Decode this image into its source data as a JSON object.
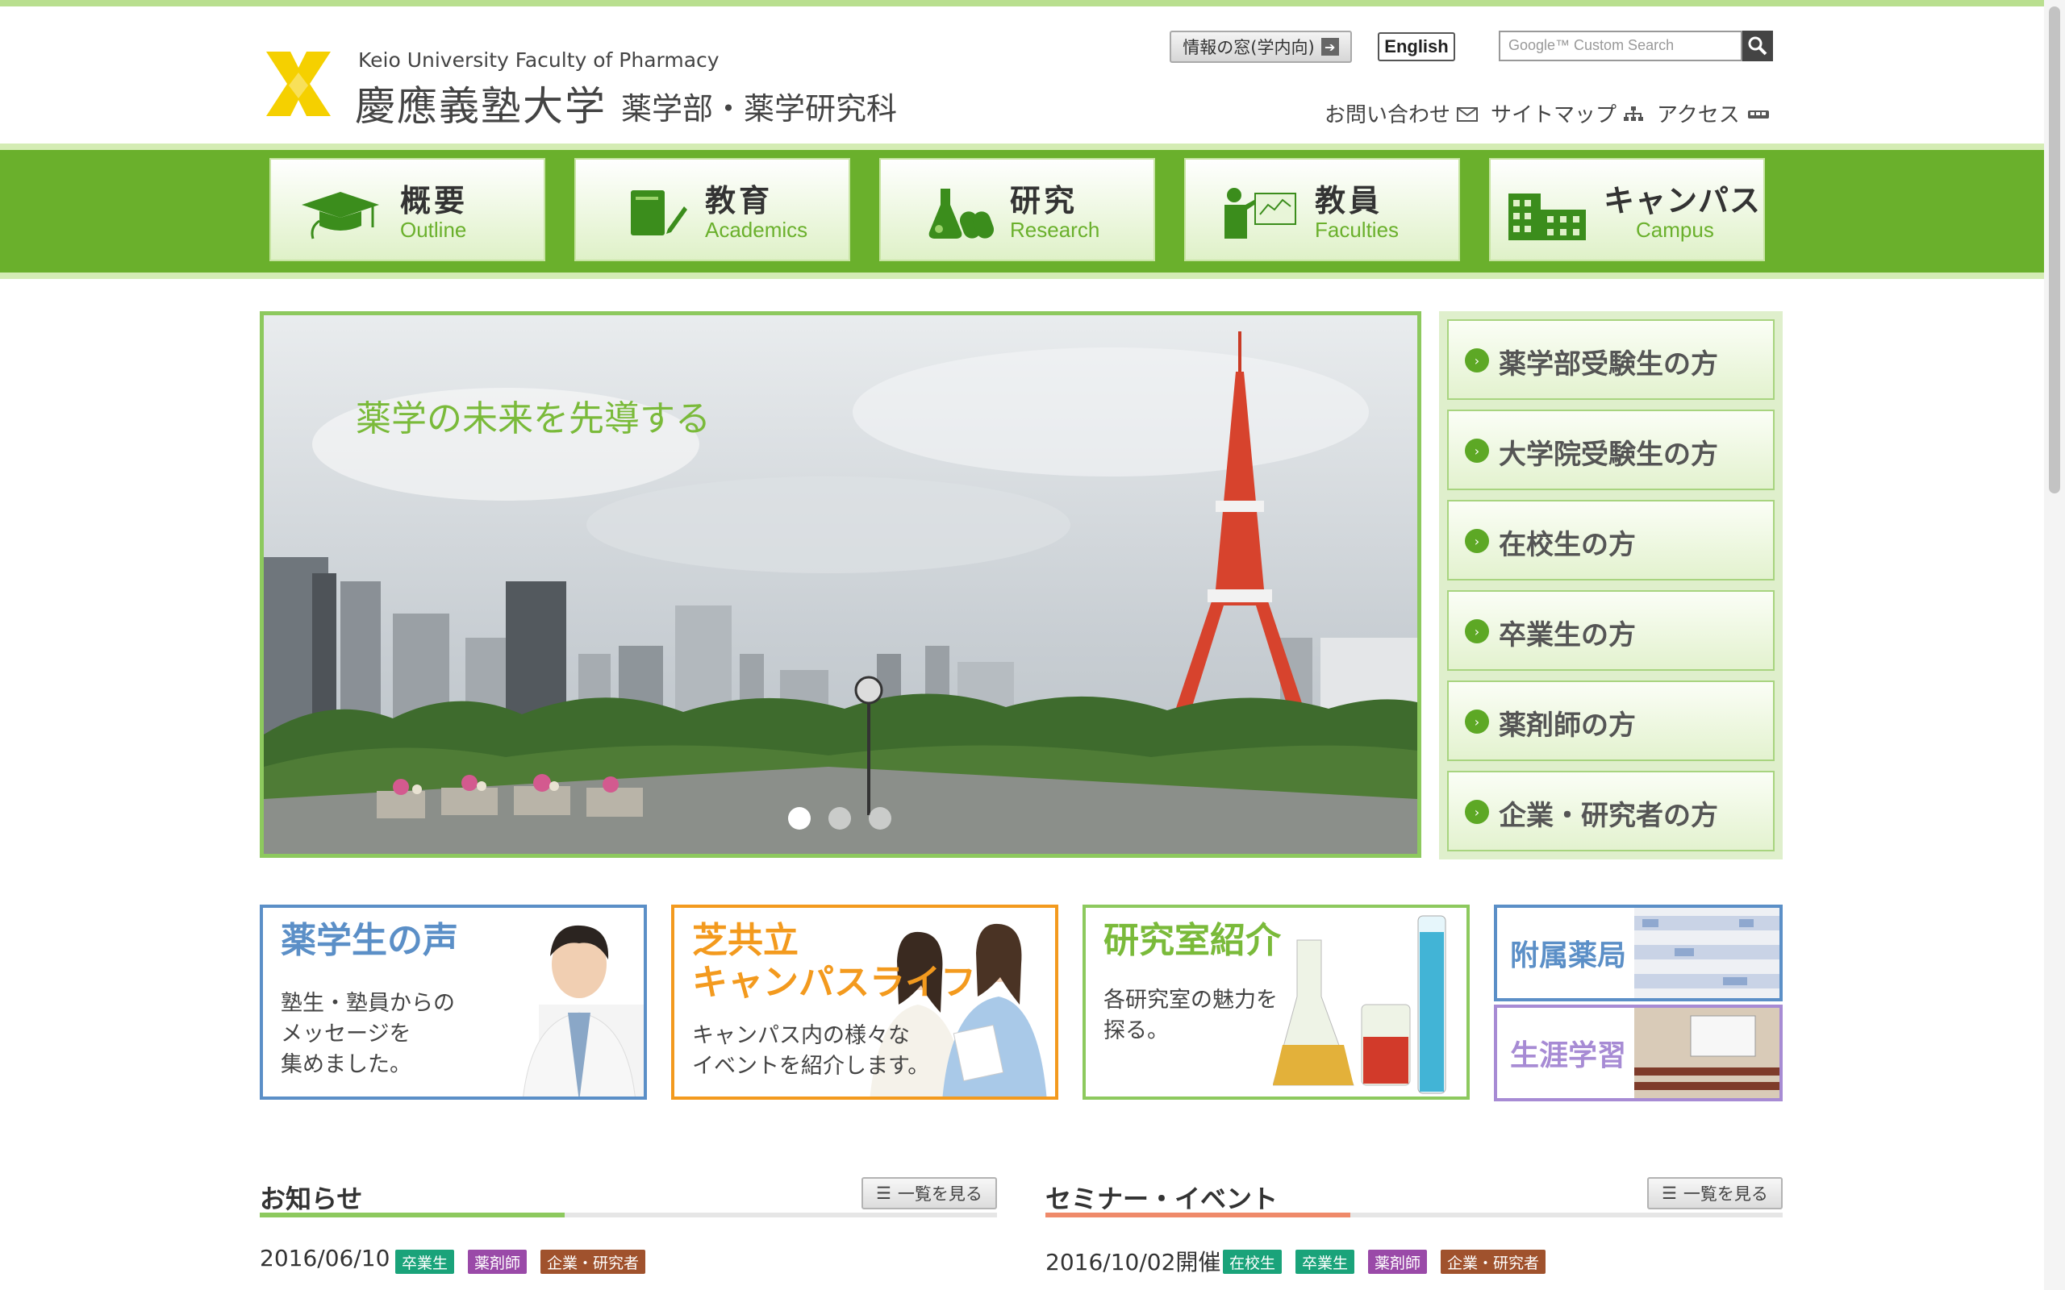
{
  "header": {
    "logo_en": "Keio University Faculty of Pharmacy",
    "logo_jp": "慶應義塾大学",
    "logo_dept": "薬学部・薬学研究科",
    "info_window_label": "情報の窓(学内向)",
    "english_label": "English",
    "search_placeholder": "Google™ Custom Search",
    "utility": {
      "contact": "お問い合わせ",
      "sitemap": "サイトマップ",
      "access": "アクセス"
    }
  },
  "nav": [
    {
      "jp": "概要",
      "en": "Outline",
      "icon": "graduation-cap-icon"
    },
    {
      "jp": "教育",
      "en": "Academics",
      "icon": "notebook-pencil-icon"
    },
    {
      "jp": "研究",
      "en": "Research",
      "icon": "flask-capsule-icon"
    },
    {
      "jp": "教員",
      "en": "Faculties",
      "icon": "teacher-board-icon"
    },
    {
      "jp": "キャンパス",
      "en": "Campus",
      "icon": "building-icon"
    }
  ],
  "hero": {
    "caption": "薬学の未来を先導する",
    "slides": 3,
    "active_slide": 1
  },
  "side_menu": [
    "薬学部受験生の方",
    "大学院受験生の方",
    "在校生の方",
    "卒業生の方",
    "薬剤師の方",
    "企業・研究者の方"
  ],
  "banners": {
    "voice": {
      "title": "薬学生の声",
      "desc": [
        "塾生・塾員からの",
        "メッセージを",
        "集めました。"
      ]
    },
    "campus": {
      "title": [
        "芝共立",
        "キャンパスライフ"
      ],
      "desc": [
        "キャンパス内の様々な",
        "イベントを紹介します。"
      ]
    },
    "labs": {
      "title": "研究室紹介",
      "desc": [
        "各研究室の魅力を",
        "探る。"
      ]
    },
    "pharmacy": {
      "title": "附属薬局"
    },
    "lifelong": {
      "title": "生涯学習"
    }
  },
  "news": {
    "title": "お知らせ",
    "list_button": "一覧を見る",
    "entry_date": "2016/06/10",
    "tags": [
      "卒業生",
      "薬剤師",
      "企業・研究者"
    ]
  },
  "seminar": {
    "title": "セミナー・イベント",
    "list_button": "一覧を見る",
    "entry_date": "2016/10/02開催",
    "tags": [
      "在校生",
      "卒業生",
      "薬剤師",
      "企業・研究者"
    ]
  },
  "colors": {
    "brand_green": "#6ab02c",
    "logo_yellow": "#f5d000",
    "voice_blue": "#5b8fc7",
    "campus_orange": "#f39a1e",
    "lab_green": "#8dc95e",
    "lifelong_purple": "#a78bd4",
    "tag_teal": "#1aa37a",
    "tag_purple": "#9a4aa8",
    "tag_brown": "#a0522d"
  }
}
